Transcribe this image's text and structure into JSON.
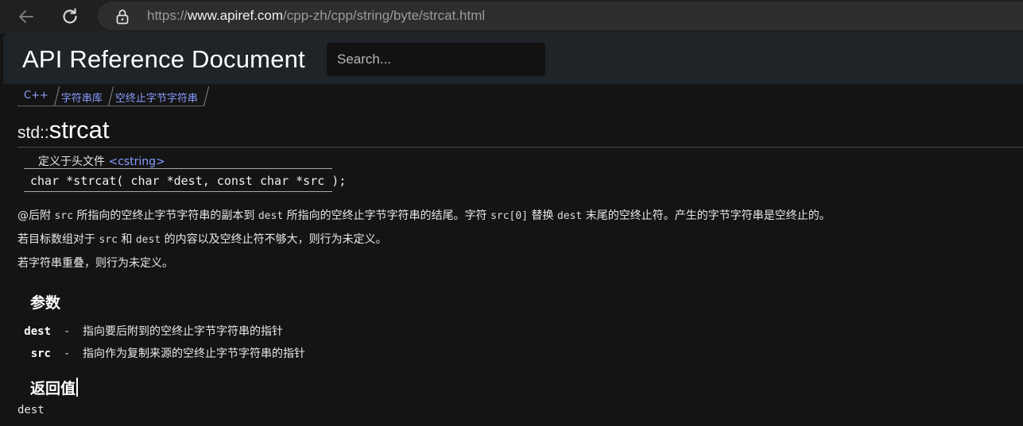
{
  "browser": {
    "url_scheme": "https://",
    "url_host": "www.apiref.com",
    "url_path": "/cpp-zh/cpp/string/byte/strcat.html"
  },
  "header": {
    "site_title": "API Reference Document",
    "search_placeholder": "Search..."
  },
  "breadcrumb": [
    "C++",
    "字符串库",
    "空终止字节字符串"
  ],
  "title": {
    "namespace": "std::",
    "name": "strcat"
  },
  "declaration": {
    "defined_in_label": "定义于头文件",
    "header": "<cstring>",
    "signature": "char *strcat( char *dest, const char *src );"
  },
  "description": {
    "line1": [
      {
        "t": "@后附 ",
        "code": false
      },
      {
        "t": "src",
        "code": true
      },
      {
        "t": " 所指向的空终止字节字符串的副本到 ",
        "code": false
      },
      {
        "t": "dest",
        "code": true
      },
      {
        "t": " 所指向的空终止字节字符串的结尾。字符 ",
        "code": false
      },
      {
        "t": "src[0]",
        "code": true
      },
      {
        "t": " 替换 ",
        "code": false
      },
      {
        "t": "dest",
        "code": true
      },
      {
        "t": " 末尾的空终止符。产生的字节字符串是空终止的。",
        "code": false
      }
    ],
    "line2": [
      {
        "t": "若目标数组对于 ",
        "code": false
      },
      {
        "t": "src",
        "code": true
      },
      {
        "t": " 和 ",
        "code": false
      },
      {
        "t": "dest",
        "code": true
      },
      {
        "t": " 的内容以及空终止符不够大，则行为未定义。",
        "code": false
      }
    ],
    "line3": "若字符串重叠，则行为未定义。"
  },
  "params": {
    "heading": "参数",
    "items": [
      {
        "name": "dest",
        "dash": "-",
        "desc": "指向要后附到的空终止字节字符串的指针"
      },
      {
        "name": "src",
        "dash": "-",
        "desc": "指向作为复制来源的空终止字节字符串的指针"
      }
    ]
  },
  "return_section": {
    "heading": "返回值",
    "value": "dest"
  },
  "colors": {
    "page_bg": "#141414",
    "header_bg": "#1f2428",
    "link": "#8a9cff"
  }
}
